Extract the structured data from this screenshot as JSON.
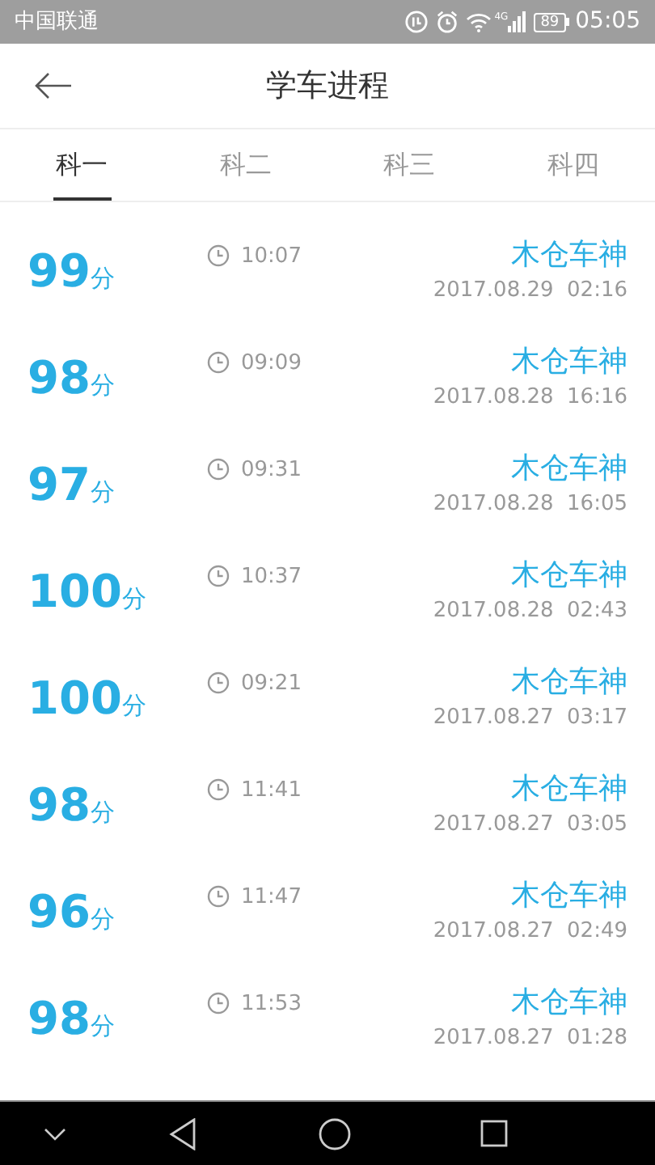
{
  "status_bar": {
    "carrier": "中国联通",
    "network": "4G",
    "battery": "89",
    "time": "05:05"
  },
  "header": {
    "title": "学车进程"
  },
  "tabs": [
    {
      "label": "科一",
      "selected": true
    },
    {
      "label": "科二",
      "selected": false
    },
    {
      "label": "科三",
      "selected": false
    },
    {
      "label": "科四",
      "selected": false
    }
  ],
  "records": [
    {
      "score": "99",
      "unit": "分",
      "duration": "10:07",
      "name": "木仓车神",
      "date": "2017.08.29  02:16"
    },
    {
      "score": "98",
      "unit": "分",
      "duration": "09:09",
      "name": "木仓车神",
      "date": "2017.08.28  16:16"
    },
    {
      "score": "97",
      "unit": "分",
      "duration": "09:31",
      "name": "木仓车神",
      "date": "2017.08.28  16:05"
    },
    {
      "score": "100",
      "unit": "分",
      "duration": "10:37",
      "name": "木仓车神",
      "date": "2017.08.28  02:43"
    },
    {
      "score": "100",
      "unit": "分",
      "duration": "09:21",
      "name": "木仓车神",
      "date": "2017.08.27  03:17"
    },
    {
      "score": "98",
      "unit": "分",
      "duration": "11:41",
      "name": "木仓车神",
      "date": "2017.08.27  03:05"
    },
    {
      "score": "96",
      "unit": "分",
      "duration": "11:47",
      "name": "木仓车神",
      "date": "2017.08.27  02:49"
    },
    {
      "score": "98",
      "unit": "分",
      "duration": "11:53",
      "name": "木仓车神",
      "date": "2017.08.27  01:28"
    }
  ]
}
